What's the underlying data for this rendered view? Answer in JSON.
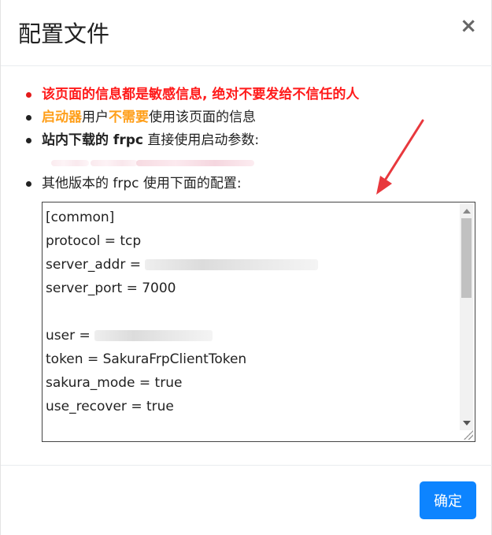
{
  "dialog": {
    "title": "配置文件",
    "close_symbol": "×",
    "confirm_label": "确定"
  },
  "notes": {
    "warning": "该页面的信息都是敏感信息, 绝对不要发给不信任的人",
    "launcher_prefix": "启动器",
    "launcher_mid": "用户",
    "launcher_emph": "不需要",
    "launcher_suffix": "使用该页面的信息",
    "download_bold": "站内下载的 frpc",
    "download_rest": " 直接使用启动参数:",
    "other_version": "其他版本的 frpc 使用下面的配置:"
  },
  "config": {
    "lines": [
      "[common]",
      "protocol = tcp",
      "server_addr = ",
      "server_port = 7000",
      "",
      "user = ",
      "token = SakuraFrpClientToken",
      "sakura_mode = true",
      "use_recover = true"
    ]
  },
  "colors": {
    "warning": "#ff1a1a",
    "emphasis": "#ff9f1a",
    "primary_button": "#0d84ff",
    "annotation_arrow": "#e8383d"
  }
}
